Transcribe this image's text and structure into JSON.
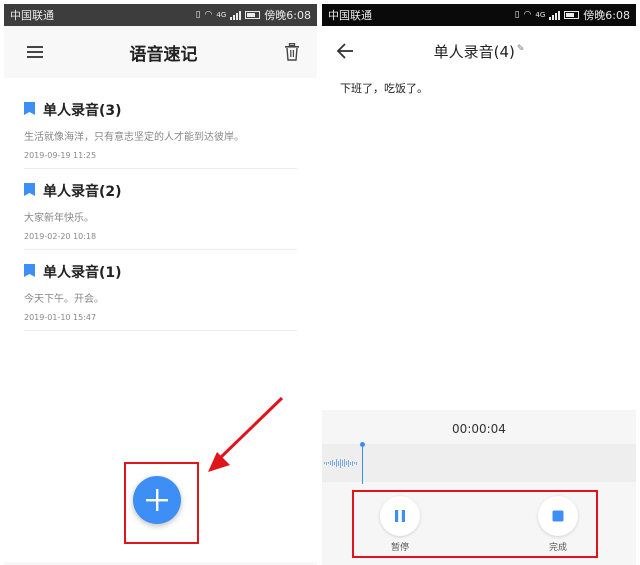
{
  "left_screen": {
    "status": {
      "carrier": "中国联通",
      "time": "傍晚6:08",
      "signal": "4G"
    },
    "header": {
      "title": "语音速记",
      "menu_icon": "menu-icon",
      "delete_icon": "trash-icon"
    },
    "notes": [
      {
        "title": "单人录音(3)",
        "preview": "生活就像海洋，只有意志坚定的人才能到达彼岸。",
        "date": "2019-09-19 11:25"
      },
      {
        "title": "单人录音(2)",
        "preview": "大家新年快乐。",
        "date": "2019-02-20 10:18"
      },
      {
        "title": "单人录音(1)",
        "preview": "今天下午。开会。",
        "date": "2019-01-10 15:47"
      }
    ],
    "fab_icon": "plus-icon"
  },
  "right_screen": {
    "status": {
      "carrier": "中国联通",
      "time": "傍晚6:08",
      "signal": "4G"
    },
    "header": {
      "title": "单人录音(4)",
      "back_icon": "arrow-left-icon",
      "edit_icon": "edit-icon"
    },
    "transcript": "下班了，吃饭了。",
    "recording": {
      "timer": "00:00:04",
      "pause_label": "暂停",
      "finish_label": "完成"
    }
  },
  "colors": {
    "accent": "#3d8ef5",
    "highlight": "#e0141b",
    "statusbar": "#3d3d3d"
  }
}
